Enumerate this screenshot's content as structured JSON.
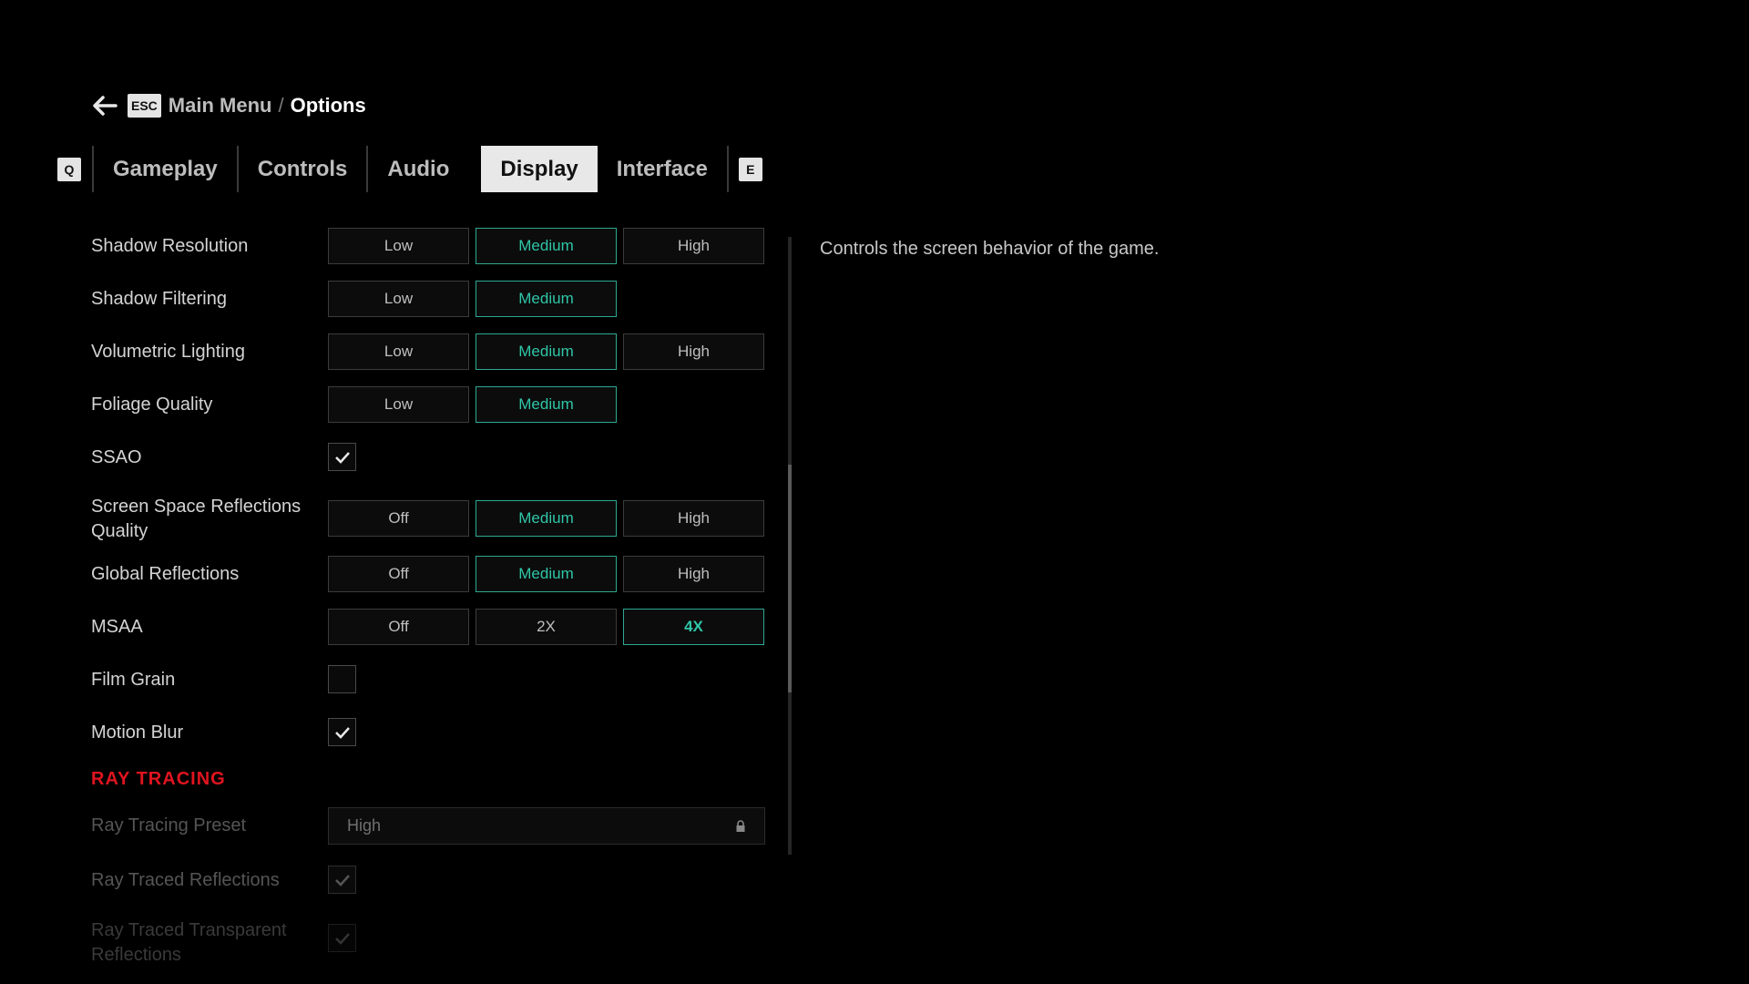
{
  "breadcrumb": {
    "esc_key": "ESC",
    "parent": "Main Menu",
    "separator": "/",
    "current": "Options"
  },
  "tabs": {
    "prev_key": "Q",
    "next_key": "E",
    "items": [
      {
        "label": "Gameplay",
        "active": false
      },
      {
        "label": "Controls",
        "active": false
      },
      {
        "label": "Audio",
        "active": false
      },
      {
        "label": "Display",
        "active": true
      },
      {
        "label": "Interface",
        "active": false
      }
    ]
  },
  "settings": [
    {
      "label": "Shadow Resolution",
      "type": "options",
      "options": [
        "Low",
        "Medium",
        "High"
      ],
      "selected": "Medium"
    },
    {
      "label": "Shadow Filtering",
      "type": "options",
      "options": [
        "Low",
        "Medium"
      ],
      "selected": "Medium"
    },
    {
      "label": "Volumetric Lighting",
      "type": "options",
      "options": [
        "Low",
        "Medium",
        "High"
      ],
      "selected": "Medium"
    },
    {
      "label": "Foliage Quality",
      "type": "options",
      "options": [
        "Low",
        "Medium"
      ],
      "selected": "Medium"
    },
    {
      "label": "SSAO",
      "type": "checkbox",
      "checked": true
    },
    {
      "label": "Screen Space Reflections Quality",
      "type": "options",
      "options": [
        "Off",
        "Medium",
        "High"
      ],
      "selected": "Medium"
    },
    {
      "label": "Global Reflections",
      "type": "options",
      "options": [
        "Off",
        "Medium",
        "High"
      ],
      "selected": "Medium"
    },
    {
      "label": "MSAA",
      "type": "options",
      "options": [
        "Off",
        "2X",
        "4X"
      ],
      "selected": "4X"
    },
    {
      "label": "Film Grain",
      "type": "checkbox",
      "checked": false
    },
    {
      "label": "Motion Blur",
      "type": "checkbox",
      "checked": true
    }
  ],
  "ray_tracing": {
    "section_title": "RAY TRACING",
    "preset_label": "Ray Tracing Preset",
    "preset_value": "High",
    "preset_icon": "lock-icon",
    "reflections_label": "Ray Traced Reflections",
    "reflections_checked": true,
    "transparent_label": "Ray Traced Transparent Reflections",
    "transparent_checked": true
  },
  "description": "Controls the screen behavior of the game.",
  "colors": {
    "accent": "#2fc6a8",
    "section": "#e0141f"
  }
}
